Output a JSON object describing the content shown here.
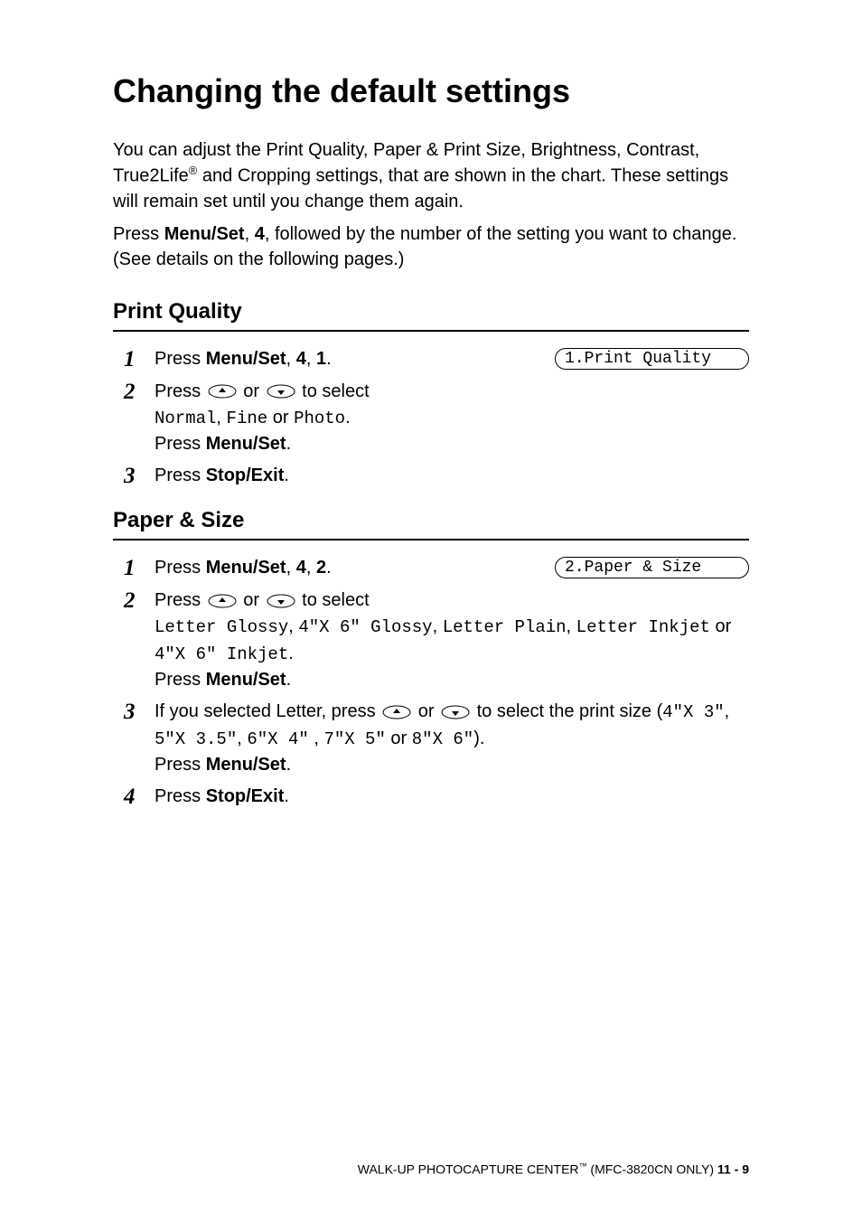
{
  "page": {
    "title": "Changing the default settings",
    "intro1_a": "You can adjust the Print Quality, Paper & Print Size, Brightness, Contrast, True2Life",
    "intro1_sup": "®",
    "intro1_b": " and Cropping settings, that are shown in the chart. These settings will remain set until you change them again.",
    "intro2_a": "Press ",
    "intro2_menu": "Menu/Set",
    "intro2_b": ", ",
    "intro2_four": "4",
    "intro2_c": ", followed by the number of the setting you want to change. (See details on the following pages.)"
  },
  "section1": {
    "title": "Print Quality",
    "display": "1.Print Quality",
    "step1_a": "Press ",
    "step1_menu": "Menu/Set",
    "step1_b": ", ",
    "step1_four": "4",
    "step1_c": ", ",
    "step1_one": "1",
    "step1_d": ".",
    "step2_a": "Press ",
    "step2_b": " or ",
    "step2_c": " to select ",
    "step2_opt1": "Normal",
    "step2_comma1": ", ",
    "step2_opt2": "Fine",
    "step2_or": " or ",
    "step2_opt3": "Photo",
    "step2_d": ".",
    "step2_press": "Press ",
    "step2_menu": "Menu/Set",
    "step2_end": ".",
    "step3_a": "Press ",
    "step3_stop": "Stop/Exit",
    "step3_b": "."
  },
  "section2": {
    "title": "Paper & Size",
    "display": "2.Paper & Size",
    "step1_a": "Press ",
    "step1_menu": "Menu/Set",
    "step1_b": ", ",
    "step1_four": "4",
    "step1_c": ", ",
    "step1_two": "2",
    "step1_d": ".",
    "step2_a": "Press ",
    "step2_b": " or ",
    "step2_c": " to select ",
    "step2_opt1": "Letter Glossy",
    "step2_comma1": ", ",
    "step2_opt2": "4\"X 6\" Glossy",
    "step2_comma2": ", ",
    "step2_opt3": "Letter Plain",
    "step2_comma3": ", ",
    "step2_opt4": "Letter Inkjet",
    "step2_or": " or ",
    "step2_opt5": "4\"X 6\" Inkjet",
    "step2_d": ".",
    "step2_press": "Press ",
    "step2_menu": "Menu/Set",
    "step2_end": ".",
    "step3_a": "If you selected Letter, press ",
    "step3_b": " or ",
    "step3_c": " to select the print size (",
    "step3_s1": "4\"X 3\"",
    "step3_comma1": ", ",
    "step3_s2": "5\"X 3.5\"",
    "step3_comma2": ", ",
    "step3_s3": "6\"X 4\"",
    "step3_comma3": " , ",
    "step3_s4": "7\"X 5\"",
    "step3_or": " or ",
    "step3_s5": "8\"X 6\"",
    "step3_d": ").",
    "step3_press": "Press ",
    "step3_menu": "Menu/Set",
    "step3_end": ".",
    "step4_a": "Press ",
    "step4_stop": "Stop/Exit",
    "step4_b": "."
  },
  "footer": {
    "text_a": "WALK-UP PHOTOCAPTURE CENTER",
    "tm": "™",
    "text_b": " (MFC-3820CN ONLY)   ",
    "page": "11 - 9"
  },
  "icons": {
    "up": "up-arrow-icon",
    "down": "down-arrow-icon"
  }
}
